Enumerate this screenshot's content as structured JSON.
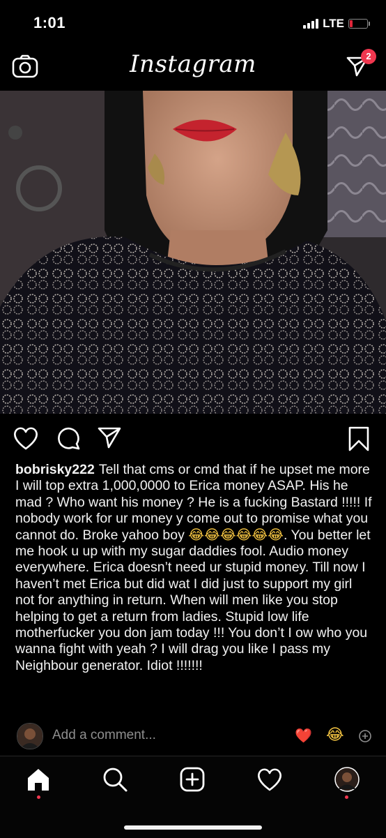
{
  "status_bar": {
    "time": "1:01",
    "network": "LTE",
    "battery_color": "#e0263a"
  },
  "header": {
    "title": "Instagram",
    "camera_icon": "camera-icon",
    "direct_icon": "direct-message-icon",
    "direct_badge_count": "2",
    "badge_color": "#f0374f"
  },
  "post": {
    "photo_alt": "post-photo",
    "actions": {
      "like_icon": "heart-icon",
      "comment_icon": "comment-icon",
      "share_icon": "share-icon",
      "save_icon": "bookmark-icon"
    },
    "caption": {
      "username": "bobrisky222",
      "text_part1": "Tell that cms or cmd that if he upset me more I will top extra 1,000,0000 to Erica money ASAP. His he mad ? Who want his money ? He is a fucking Bastard !!!!! If nobody work for ur money y come out to promise what you cannot do. Broke yahoo boy",
      "emojis": "😂😂😂😂😂😂",
      "text_part2": ". You better let me hook u up with my sugar daddies fool.  Audio money everywhere. Erica doesn’t need ur stupid money. Till now I haven’t met Erica but did wat I did just to support my girl not for anything in return. When will men like you stop helping to get a return from ladies. Stupid low life motherfucker you don jam today !!! You don’t I ow who you wanna fight with yeah ? I will drag you like I pass my Neighbour generator. Idiot !!!!!!!"
    },
    "comment_box": {
      "placeholder": "Add a comment...",
      "quick_emoji_1": "❤️",
      "quick_emoji_2": "😂"
    }
  },
  "bottom_nav": {
    "items": [
      "home-icon",
      "search-icon",
      "new-post-icon",
      "activity-icon",
      "profile-avatar"
    ],
    "active": "home-icon"
  }
}
